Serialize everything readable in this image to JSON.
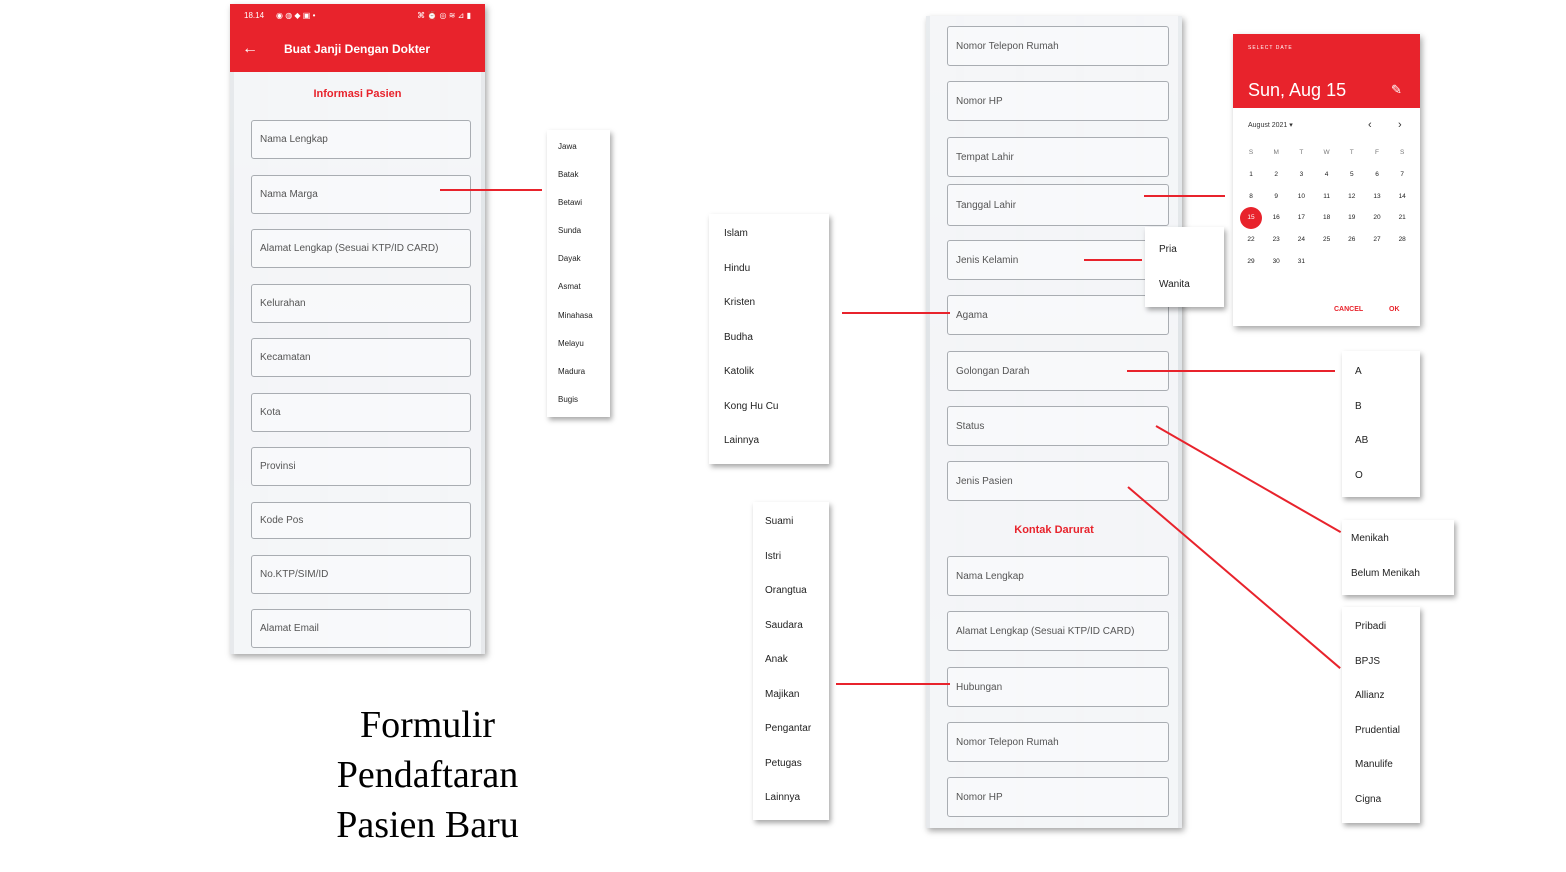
{
  "screen1": {
    "status_time": "18.14",
    "status_left_icons": "◉ ◍ ◆ ▣ •",
    "status_right_icons": "⌘ ⏰ ◎ ≋ ⊿ ▮",
    "back_icon": "←",
    "app_title": "Buat Janji Dengan Dokter",
    "section_title": "Informasi Pasien",
    "fields": [
      "Nama Lengkap",
      "Nama Marga",
      "Alamat Lengkap (Sesuai KTP/ID CARD)",
      "Kelurahan",
      "Kecamatan",
      "Kota",
      "Provinsi",
      "Kode Pos",
      "No.KTP/SIM/ID",
      "Alamat Email"
    ]
  },
  "marga_options": [
    "Jawa",
    "Batak",
    "Betawi",
    "Sunda",
    "Dayak",
    "Asmat",
    "Minahasa",
    "Melayu",
    "Madura",
    "Bugis"
  ],
  "caption": [
    "Formulir",
    "Pendaftaran",
    "Pasien Baru"
  ],
  "screen2": {
    "fields_top": [
      "Nomor Telepon Rumah",
      "Nomor HP",
      "Tempat Lahir",
      "Tanggal Lahir",
      "Jenis Kelamin",
      "Agama",
      "Golongan Darah",
      "Status",
      "Jenis Pasien"
    ],
    "section_title": "Kontak Darurat",
    "fields_bottom": [
      "Nama Lengkap",
      "Alamat Lengkap (Sesuai KTP/ID CARD)",
      "Hubungan",
      "Nomor Telepon Rumah",
      "Nomor HP"
    ]
  },
  "agama_options": [
    "Islam",
    "Hindu",
    "Kristen",
    "Budha",
    "Katolik",
    "Kong Hu Cu",
    "Lainnya"
  ],
  "hubungan_options": [
    "Suami",
    "Istri",
    "Orangtua",
    "Saudara",
    "Anak",
    "Majikan",
    "Pengantar",
    "Petugas",
    "Lainnya"
  ],
  "jenis_kelamin_options": [
    "Pria",
    "Wanita"
  ],
  "golongan_darah_options": [
    "A",
    "B",
    "AB",
    "O"
  ],
  "status_options": [
    "Menikah",
    "Belum Menikah"
  ],
  "jenis_pasien_options": [
    "Pribadi",
    "BPJS",
    "Allianz",
    "Prudential",
    "Manulife",
    "Cigna"
  ],
  "date_picker": {
    "header_label": "SELECT DATE",
    "selected_date": "Sun, Aug 15",
    "edit_icon": "✎",
    "month_label": "August 2021 ▾",
    "prev_icon": "‹",
    "next_icon": "›",
    "weekdays": [
      "S",
      "M",
      "T",
      "W",
      "T",
      "F",
      "S"
    ],
    "days": [
      "1",
      "2",
      "3",
      "4",
      "5",
      "6",
      "7",
      "8",
      "9",
      "10",
      "11",
      "12",
      "13",
      "14",
      "15",
      "16",
      "17",
      "18",
      "19",
      "20",
      "21",
      "22",
      "23",
      "24",
      "25",
      "26",
      "27",
      "28",
      "29",
      "30",
      "31"
    ],
    "selected_day": "15",
    "cancel_label": "CANCEL",
    "ok_label": "OK"
  },
  "colors": {
    "accent": "#e8232c",
    "field_border": "#a9adb2",
    "text": "#555555"
  }
}
